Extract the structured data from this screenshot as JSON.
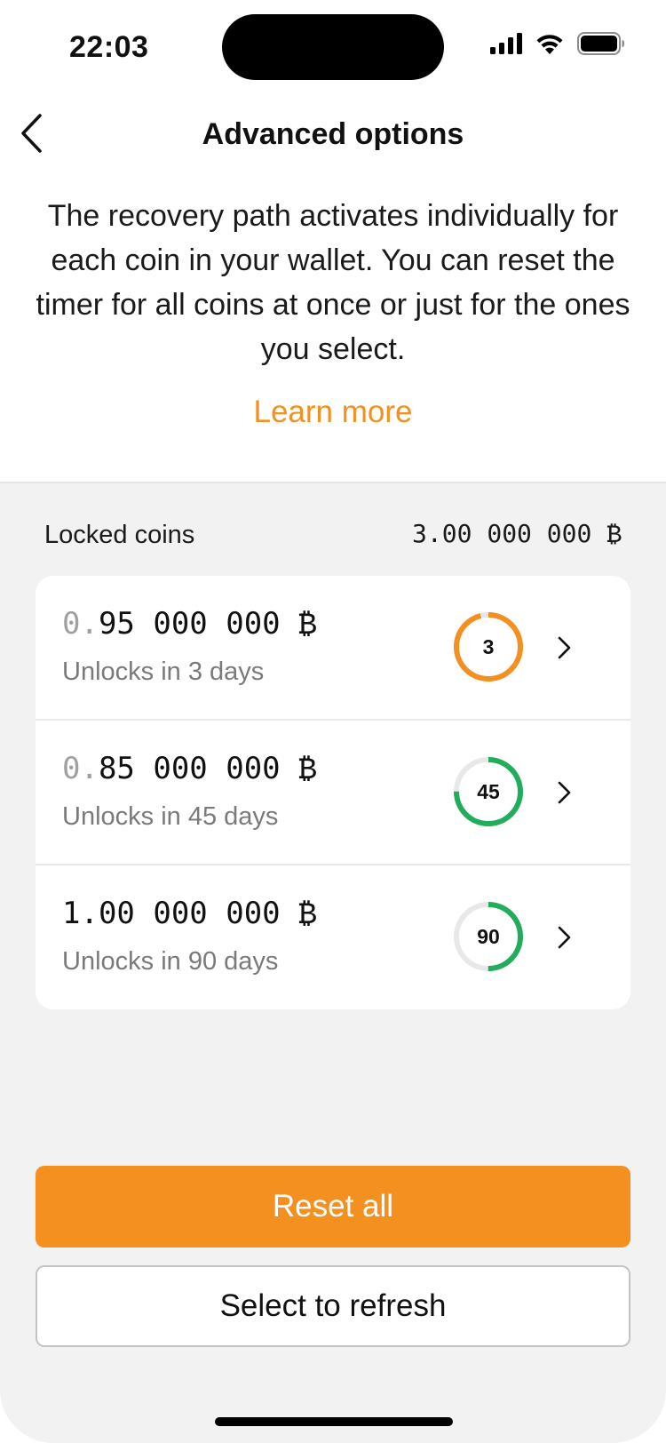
{
  "status_bar": {
    "time": "22:03",
    "icons": [
      "cellular-signal-icon",
      "wifi-icon",
      "battery-icon"
    ]
  },
  "header": {
    "back_icon": "chevron-left-icon",
    "title": "Advanced options"
  },
  "intro": {
    "text": "The recovery path activates individually for each coin in your wallet. You can reset the timer for all coins at once or just for the ones you select."
  },
  "learn_more": {
    "label": "Learn more",
    "color": "#F39020"
  },
  "locked": {
    "label": "Locked coins",
    "total": "3.00 000 000 ₿"
  },
  "coins": [
    {
      "amount_lead": "0.",
      "amount_rest": "95 000 000 ₿",
      "unlock_text": "Unlocks in 3 days",
      "days": "3",
      "progress": 0.96,
      "ring_color": "#F39020"
    },
    {
      "amount_lead": "0.",
      "amount_rest": "85 000 000 ₿",
      "unlock_text": "Unlocks in 45 days",
      "days": "45",
      "progress": 0.75,
      "ring_color": "#22AD5C"
    },
    {
      "amount_lead": "",
      "amount_rest": "1.00 000 000 ₿",
      "unlock_text": "Unlocks in 90 days",
      "days": "90",
      "progress": 0.5,
      "ring_color": "#22AD5C"
    }
  ],
  "row_chevron_icon": "chevron-right-icon",
  "buttons": {
    "reset_all": "Reset all",
    "select_to_refresh": "Select to refresh"
  },
  "colors": {
    "accent": "#F39020",
    "success": "#22AD5C",
    "ring_track": "#E8E8E8",
    "background_gray": "#F2F2F2"
  }
}
